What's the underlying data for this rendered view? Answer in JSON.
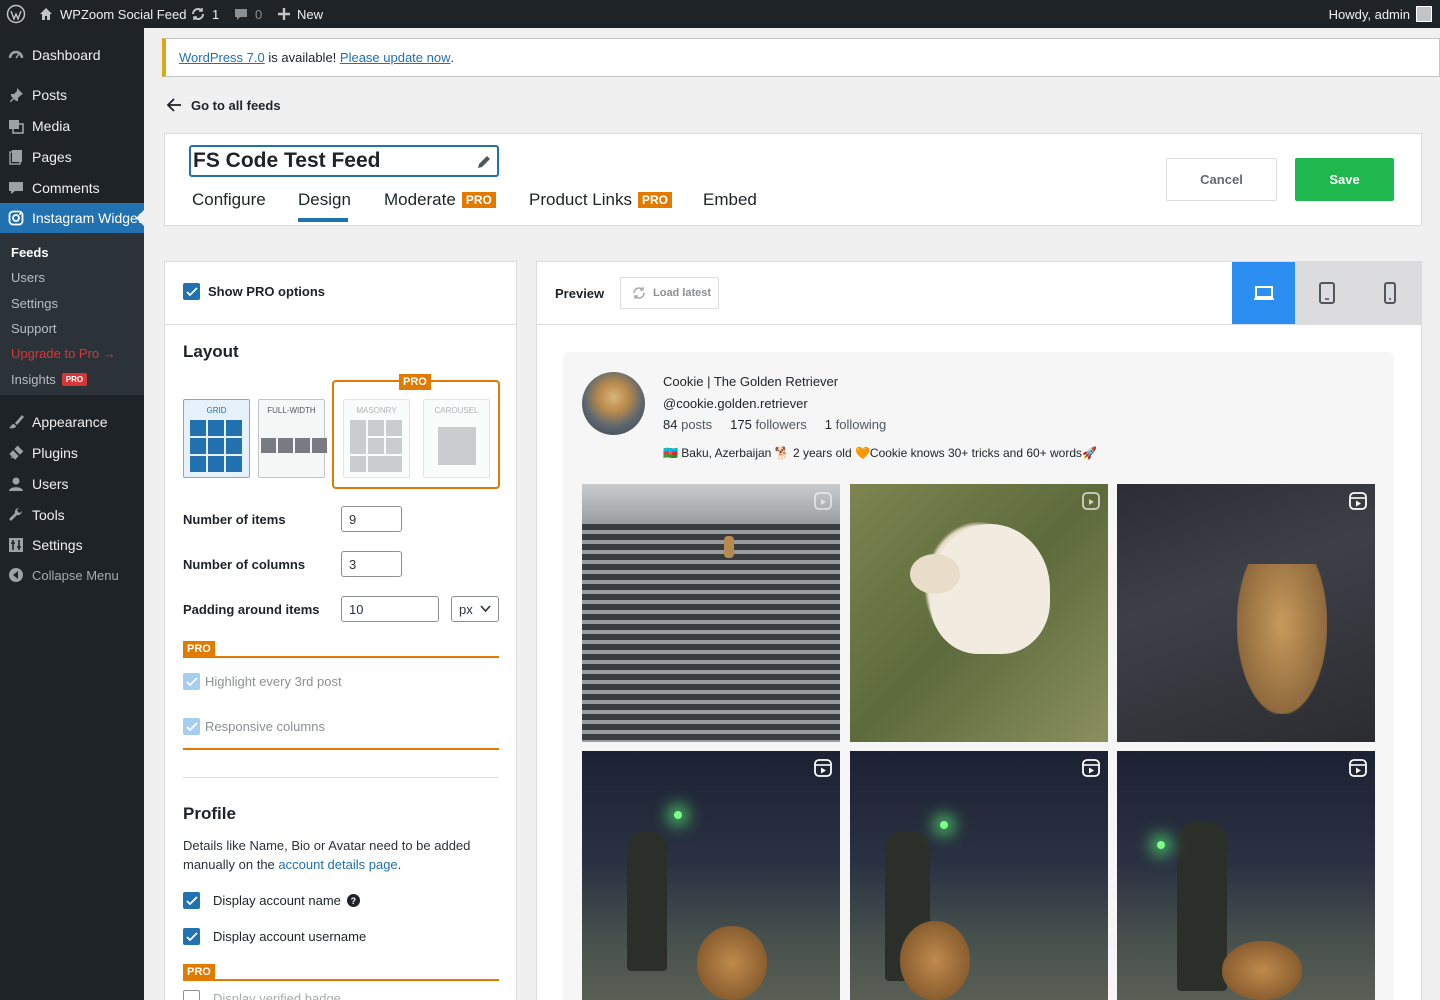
{
  "adminbar": {
    "site_name": "WPZoom Social Feed",
    "updates_count": "1",
    "comments_count": "0",
    "new_label": "New",
    "howdy": "Howdy, admin"
  },
  "sidebar": {
    "items": [
      {
        "label": "Dashboard",
        "icon": "dashboard-icon"
      },
      {
        "label": "Posts",
        "icon": "pin-icon"
      },
      {
        "label": "Media",
        "icon": "media-icon"
      },
      {
        "label": "Pages",
        "icon": "pages-icon"
      },
      {
        "label": "Comments",
        "icon": "comment-icon"
      },
      {
        "label": "Instagram Widget",
        "icon": "instagram-icon"
      },
      {
        "label": "Appearance",
        "icon": "brush-icon"
      },
      {
        "label": "Plugins",
        "icon": "plug-icon"
      },
      {
        "label": "Users",
        "icon": "user-icon"
      },
      {
        "label": "Tools",
        "icon": "wrench-icon"
      },
      {
        "label": "Settings",
        "icon": "settings-icon"
      },
      {
        "label": "Collapse Menu",
        "icon": "collapse-icon"
      }
    ],
    "submenu": [
      "Feeds",
      "Users",
      "Settings",
      "Support",
      "Upgrade to Pro →",
      "Insights"
    ],
    "pro_badge": "PRO"
  },
  "notice": {
    "link1": "WordPress 7.0",
    "middle": " is available! ",
    "link2": "Please update now",
    "end": "."
  },
  "back_link": "Go to all feeds",
  "feed": {
    "title": "FS Code Test Feed"
  },
  "tabs": [
    "Configure",
    "Design",
    "Moderate",
    "Product Links",
    "Embed"
  ],
  "pro": "PRO",
  "buttons": {
    "cancel": "Cancel",
    "save": "Save"
  },
  "settings": {
    "show_pro": "Show PRO options",
    "layout_heading": "Layout",
    "layouts": [
      "GRID",
      "FULL-WIDTH",
      "MASONRY",
      "CAROUSEL"
    ],
    "number_of_items": {
      "label": "Number of items",
      "value": "9"
    },
    "number_of_columns": {
      "label": "Number of columns",
      "value": "3"
    },
    "padding": {
      "label": "Padding around items",
      "value": "10",
      "unit": "px"
    },
    "highlight": "Highlight every 3rd post",
    "responsive": "Responsive columns",
    "profile_heading": "Profile",
    "profile_desc_1": "Details like Name, Bio or Avatar need to be added",
    "profile_desc_2": "manually on the ",
    "profile_link": "account details page",
    "profile_desc_3": ".",
    "display_name": "Display account name",
    "display_username": "Display account username",
    "verified": "Display verified badge"
  },
  "preview": {
    "label": "Preview",
    "load_latest": "Load latest",
    "profile_name": "Cookie | The Golden Retriever",
    "username": "@cookie.golden.retriever",
    "posts_num": "84",
    "posts_label": "posts",
    "followers_num": "175",
    "followers_label": "followers",
    "following_num": "1",
    "following_label": "following",
    "bio": "🇦🇿 Baku, Azerbaijan 🐕 2 years old 🧡Cookie knows 30+ tricks and 60+ words🚀"
  },
  "colors": {
    "accent": "#2271b1",
    "pro": "#e07b00",
    "save": "#1fb84f",
    "sidebar": "#1d2327"
  }
}
